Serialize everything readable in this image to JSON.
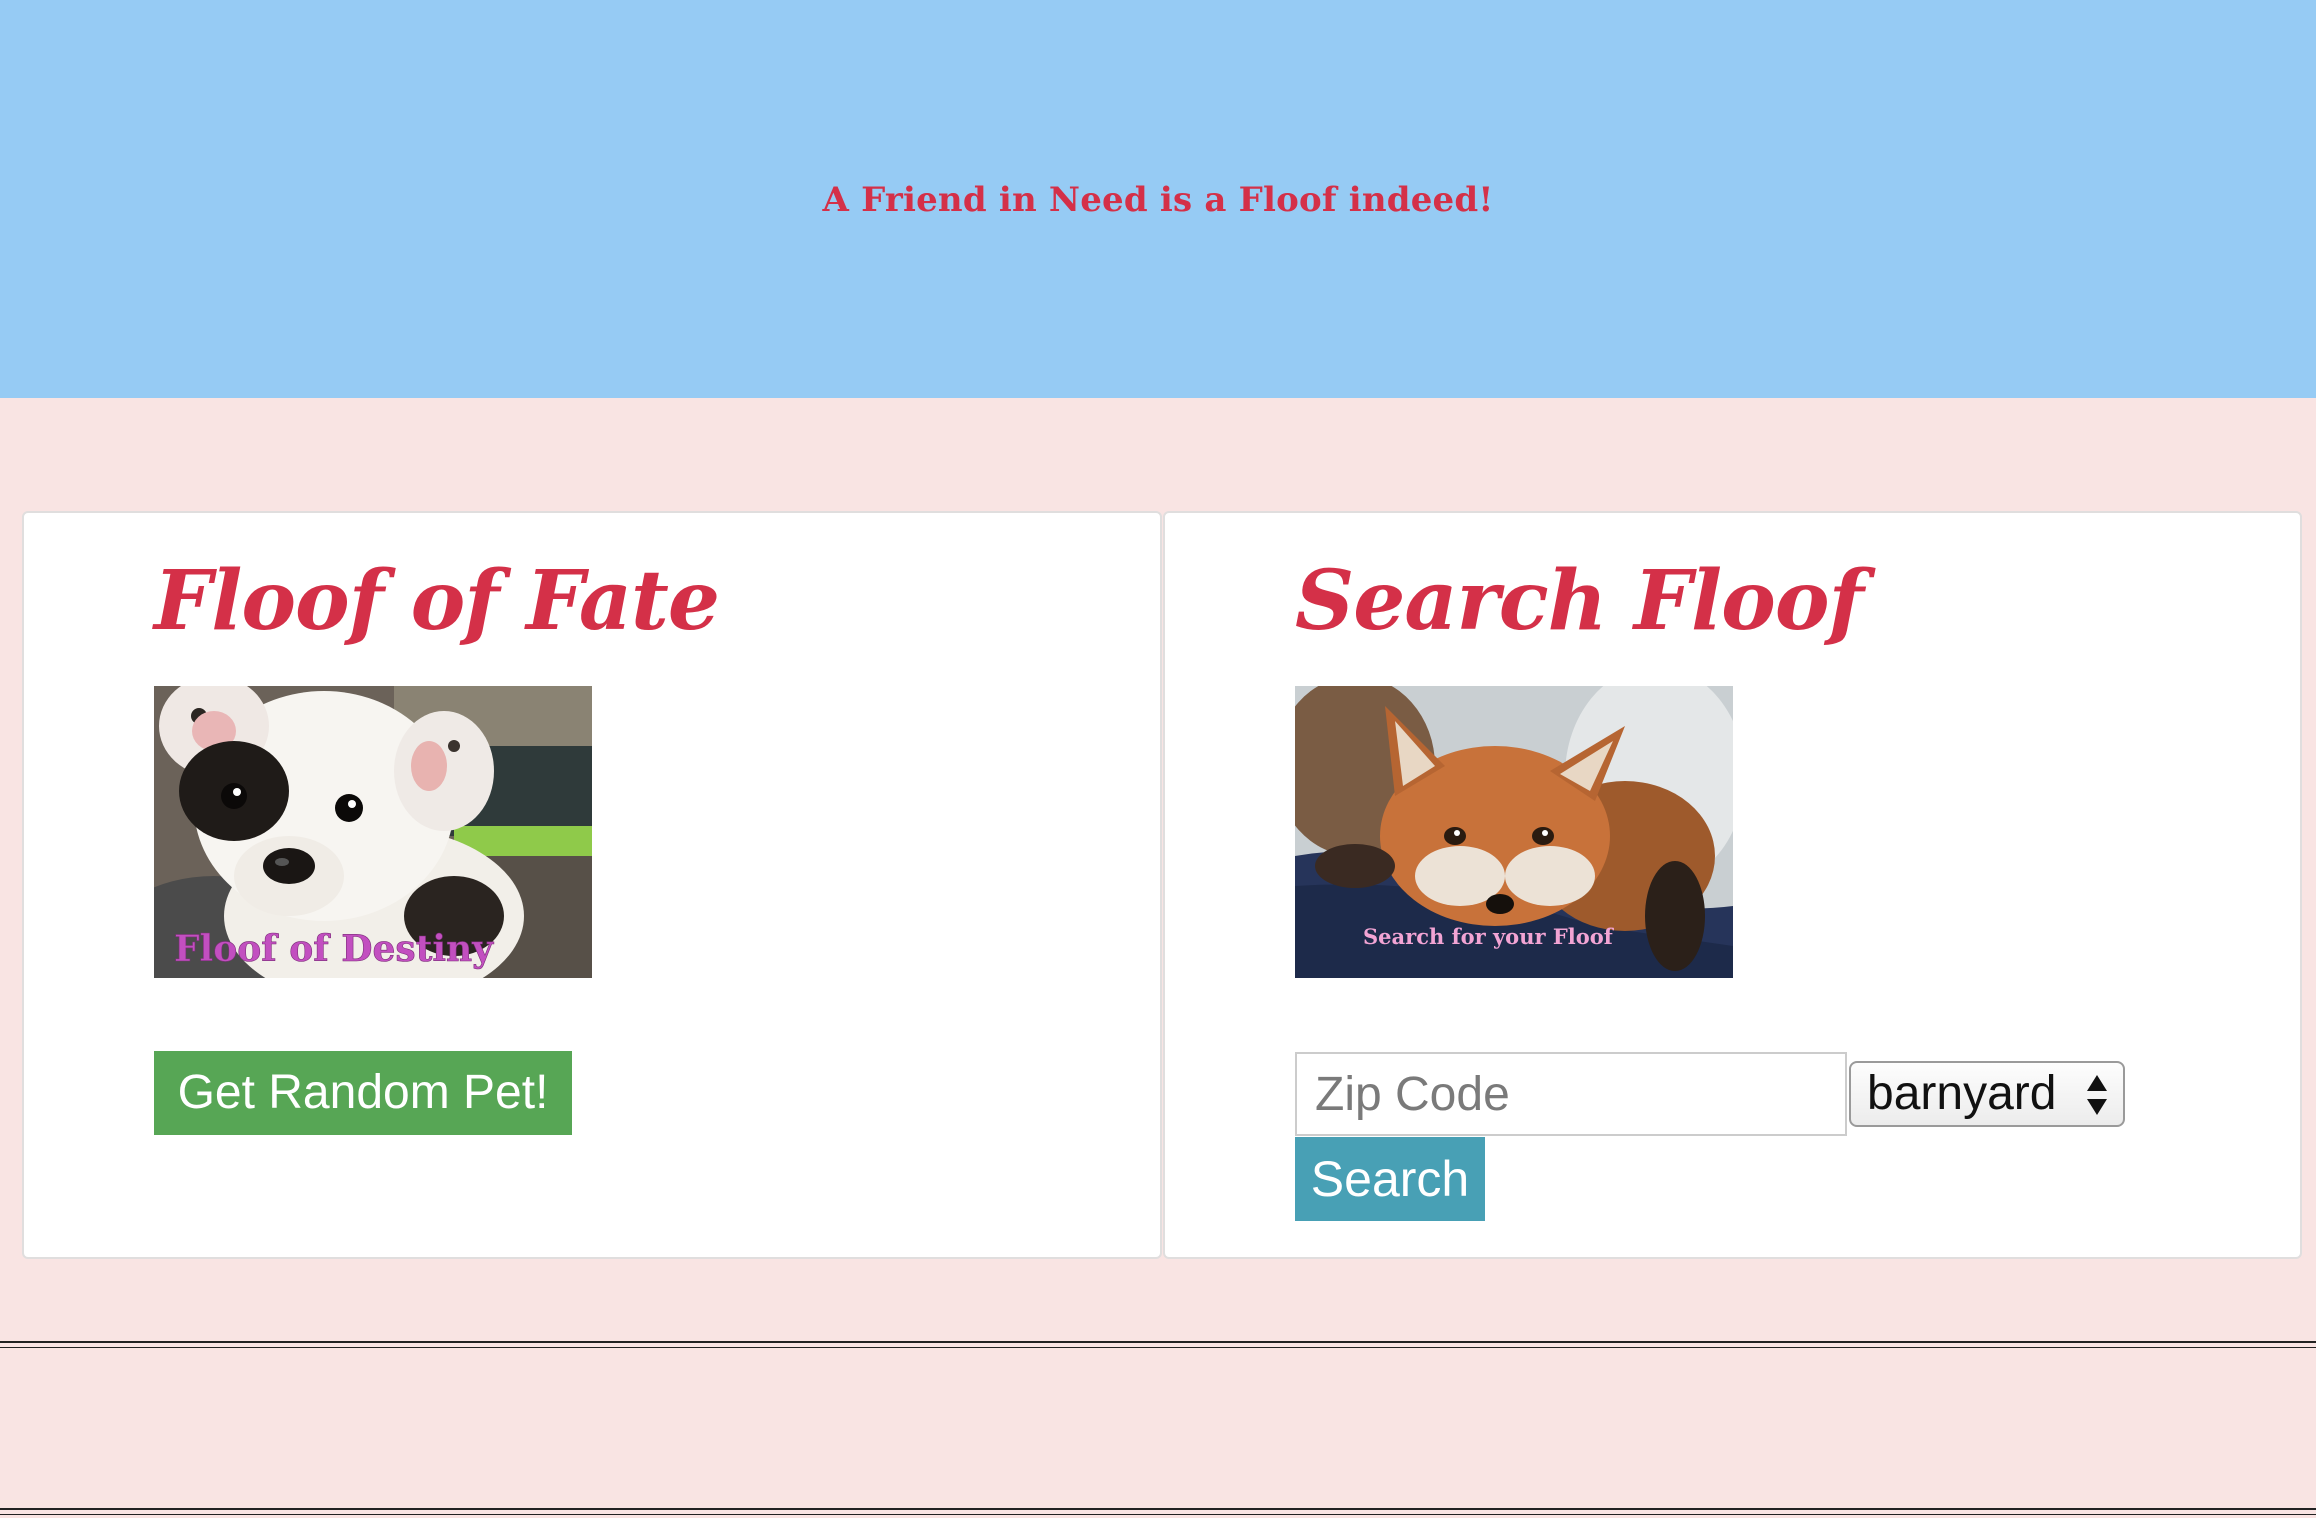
{
  "header": {
    "tagline": "A Friend in Need is a Floof indeed!"
  },
  "random_card": {
    "title": "Floof of Fate",
    "image_caption": "Floof of Destiny",
    "button_label": "Get Random Pet!"
  },
  "search_card": {
    "title": "Search Floof",
    "image_caption": "Search for your Floof",
    "zip_placeholder": "Zip Code",
    "zip_value": "",
    "animal_type_selected": "barnyard",
    "button_label": "Search"
  },
  "colors": {
    "banner": "#96cbf4",
    "page_background": "#f9e4e3",
    "title_red": "#d43048",
    "random_button_green": "#57a655",
    "search_button_teal": "#48a0b5",
    "caption_magenta": "#c24fc0"
  },
  "icons": {
    "select_arrows": "up-down-chevron-icon"
  }
}
